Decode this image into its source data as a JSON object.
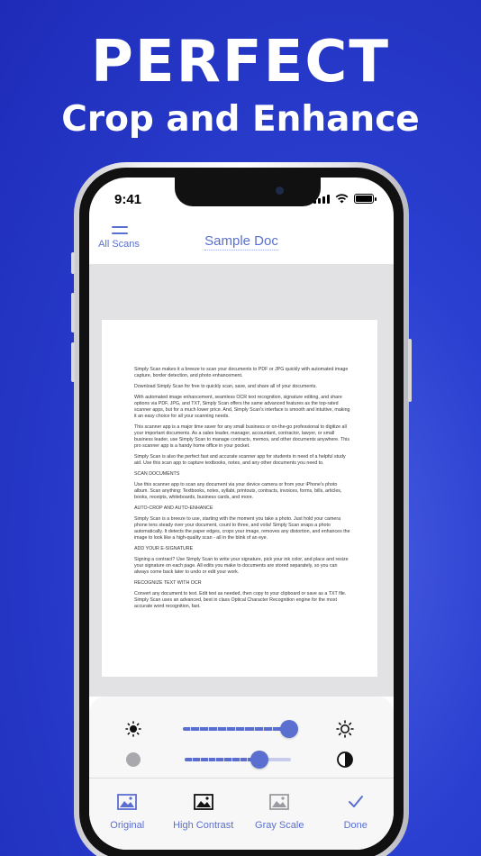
{
  "headline": {
    "line1": "PERFECT",
    "line2": "Crop and Enhance"
  },
  "status_bar": {
    "time": "9:41",
    "icons": [
      "cellular-signal-icon",
      "wifi-icon",
      "battery-icon"
    ]
  },
  "navbar": {
    "menu_label": "All Scans",
    "title": "Sample Doc"
  },
  "document": {
    "paragraphs": [
      "Simply Scan makes it a breeze to scan your documents to PDF or JPG quickly with automated image capture, border detection, and photo enhancement.",
      "Download Simply Scan for free to quickly scan, save, and share all of your documents.",
      "With automated image enhancement, seamless OCR text recognition, signature editing, and share options via PDF, JPG, and TXT, Simply Scan offers the same advanced features as the top-rated scanner apps, but for a much lower price. And, Simply Scan's interface is smooth and intuitive, making it an easy choice for all your scanning needs.",
      "This scanner app is a major time saver for any small business or on-the-go professional to digitize all your important documents. As a sales leader, manager, accountant, contractor, lawyer, or small business leader, use Simply Scan to manage contracts, memos, and other documents anywhere. This pro scanner app is a handy home office in your pocket.",
      "Simply Scan is also the perfect fast and accurate scanner app for students in need of a helpful study aid. Use this scan app to capture textbooks, notes, and any other documents you need to."
    ],
    "sections": [
      {
        "heading": "SCAN DOCUMENTS",
        "body": "Use this scanner app to scan any document via your device camera or from your iPhone's photo album. Scan anything: Textbooks, notes, syllabi, printouts, contracts, invoices, forms, bills, articles, books, receipts, whiteboards, business cards, and more."
      },
      {
        "heading": "AUTO-CROP AND AUTO-ENHANCE",
        "body": "Simply Scan is a breeze to use, starting with the moment you take a photo. Just hold your camera phone lens steady over your document, count to three, and voila! Simply Scan snaps a photo automatically. It detects the paper edges, crops your image, removes any distortion, and enhances the image to look like a high-quality scan - all in the blink of an eye."
      },
      {
        "heading": "ADD YOUR E-SIGNATURE",
        "body": "Signing a contract? Use Simply Scan to write your signature, pick your ink color, and place and resize your signature on each page. All edits you make to documents are stored separately, so you can always come back later to undo or edit your work."
      },
      {
        "heading": "RECOGNIZE TEXT WITH OCR",
        "body": "Convert any document to text. Edit text as needed, then copy to your clipboard or save as a TXT file. Simply Scan uses an advanced, best in class Optical Character Recognition engine for the most accurate word recognition, fast."
      }
    ]
  },
  "adjustments": {
    "brightness": {
      "value": 1.0,
      "min_icon": "brightness-low-icon",
      "max_icon": "brightness-high-icon"
    },
    "contrast": {
      "value": 0.74,
      "min_icon": "contrast-low-icon",
      "max_icon": "contrast-high-icon"
    }
  },
  "toolbar": {
    "original_label": "Original",
    "high_contrast_label": "High Contrast",
    "gray_scale_label": "Gray Scale",
    "done_label": "Done"
  },
  "colors": {
    "accent": "#5a6fd0",
    "background": "#2a3fd0"
  }
}
